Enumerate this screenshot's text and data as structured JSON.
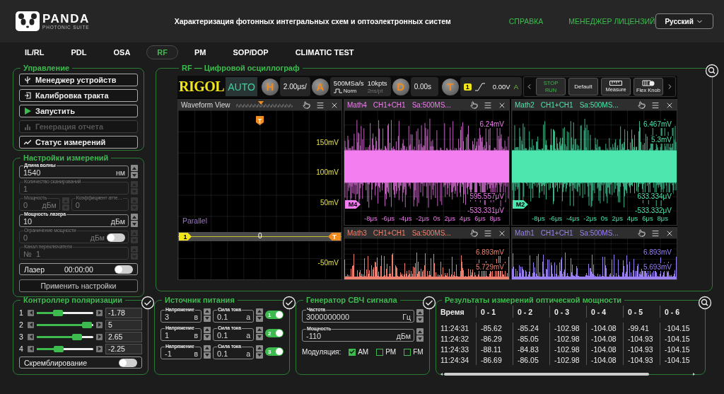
{
  "header": {
    "logo": "PANDA",
    "logo_subtitle": "PHOTONIC SUITE",
    "title": "Характеризация фотонных интегральных схем и оптоэлектронных систем",
    "links": [
      "СПРАВКА",
      "МЕНЕДЖЕР ЛИЦЕНЗИЙ"
    ],
    "language": "Русский"
  },
  "tabs": [
    {
      "label": "IL/RL",
      "selected": false
    },
    {
      "label": "PDL",
      "selected": false
    },
    {
      "label": "OSA",
      "selected": false
    },
    {
      "label": "RF",
      "selected": true
    },
    {
      "label": "PM",
      "selected": false
    },
    {
      "label": "SOP/DOP",
      "selected": false
    },
    {
      "label": "CLIMATIC TEST",
      "selected": false
    }
  ],
  "control": {
    "title": "Управление",
    "buttons": [
      {
        "label": "Менеджер устройств",
        "disabled": false
      },
      {
        "label": "Калибровка тракта",
        "disabled": false
      },
      {
        "label": "Запустить",
        "disabled": false
      },
      {
        "label": "Генерация отчета",
        "disabled": true
      },
      {
        "label": "Статус измерений",
        "disabled": false
      }
    ]
  },
  "settings": {
    "title": "Настройки измерений",
    "rows": [
      {
        "kind": "single",
        "fields": [
          {
            "label": "Длина волны",
            "value": "1540",
            "unit": "нм",
            "disabled": false
          }
        ]
      },
      {
        "kind": "single",
        "fields": [
          {
            "label": "Количество сканирований",
            "value": "1",
            "disabled": true
          }
        ]
      },
      {
        "kind": "pair",
        "fields": [
          {
            "label": "Мощность",
            "value": "0",
            "unit": "дБм",
            "disabled": true
          },
          {
            "label": "Коэффициент атте…",
            "value": "0",
            "disabled": true
          }
        ]
      },
      {
        "kind": "single",
        "fields": [
          {
            "label": "Мощность лазера",
            "value": "10",
            "unit": "дБм",
            "disabled": false
          }
        ]
      },
      {
        "kind": "toggle",
        "on": false,
        "fields": [
          {
            "label": "Ограничение мощности",
            "value": "0",
            "unit": "дБм",
            "disabled": true
          }
        ]
      },
      {
        "kind": "single",
        "fields": [
          {
            "label": "Канал переключателя",
            "value": "№  1",
            "disabled": true
          }
        ]
      }
    ],
    "laser": {
      "label": "Лазер",
      "time": "00:00:00",
      "on": false
    },
    "apply": "Применить настройки"
  },
  "scope": {
    "title": "RF — Цифровой осциллограф",
    "brand": "RIGOL",
    "mode": "AUTO",
    "horizontal": {
      "key": "H",
      "value": "2.00μs/"
    },
    "acquire": {
      "key": "A",
      "rate": "500MSa/s",
      "mode": "Norm",
      "points": "10kpts",
      "resolution": "2ns/pt"
    },
    "delay": {
      "key": "D",
      "value": "0.00s"
    },
    "trigger": {
      "key": "T",
      "channel": "1",
      "level": "0.00V",
      "mode": "A"
    },
    "buttons": [
      {
        "kind": "stoprun",
        "lines": [
          "STOP",
          "RUN"
        ]
      },
      {
        "kind": "default",
        "label": "Default"
      },
      {
        "kind": "measure",
        "label": "Measure"
      },
      {
        "kind": "knob",
        "label": "Flex Knob"
      }
    ],
    "waveform_view": {
      "title": "Waveform View",
      "y_labels": [
        "150mV",
        "100mV",
        "50mV",
        "-50mV"
      ],
      "mode": "Parallel",
      "channel": "1",
      "center": "0",
      "trigger": "T",
      "top_marker": "T"
    },
    "math_windows": [
      {
        "name": "Math4",
        "source": "CH1+CH1",
        "rate": "Sa:500MS...",
        "color": "#f27ef0",
        "readings": [
          "6.24mV"
        ],
        "bottom_readings": [
          "595.557μV",
          "-533.331μV"
        ],
        "marker": "M4",
        "x_ticks": [
          "-8μs",
          "-6μs",
          "-4μs",
          "-2μs",
          "0s",
          "2μs",
          "4μs",
          "6μs",
          "8μs"
        ]
      },
      {
        "name": "Math2",
        "source": "CH1+CH1",
        "rate": "Sa:500MS...",
        "color": "#4de6ae",
        "readings": [
          "6.467mV",
          "5.3mV"
        ],
        "bottom_readings": [
          "633.334μV",
          "-533.332μV"
        ],
        "marker": "M2",
        "x_ticks": [
          "-8μs",
          "-6μs",
          "-4μs",
          "-2μs",
          "0s",
          "2μs",
          "4μs",
          "6μs",
          "8μs"
        ]
      },
      {
        "name": "Math3",
        "source": "CH1+CH1",
        "rate": "Sa:500MS...",
        "color": "#f0806e",
        "readings": [
          "6.893mV",
          "5.729mV"
        ]
      },
      {
        "name": "Math1",
        "source": "CH1+CH1",
        "rate": "Sa:500MS...",
        "color": "#9b80f2",
        "readings": [
          "6.893mV",
          "5.693mV"
        ]
      }
    ]
  },
  "polarization": {
    "title": "Контроллер поляризации",
    "channels": [
      {
        "label": "1",
        "level": 0.35,
        "value": "-1.78"
      },
      {
        "label": "2",
        "level": 0.97,
        "value": "5"
      },
      {
        "label": "3",
        "level": 0.76,
        "value": "2.65"
      },
      {
        "label": "4",
        "level": 0.37,
        "value": "-2.25"
      }
    ],
    "scrambling": {
      "label": "Скремблирование",
      "on": false
    }
  },
  "power": {
    "title": "Источник питания",
    "channels": [
      {
        "voltage": {
          "label": "Напряжение",
          "value": "3",
          "unit": "в"
        },
        "current": {
          "label": "Сила тока",
          "value": "0.1",
          "unit": "а"
        },
        "channel": "1",
        "on": true
      },
      {
        "voltage": {
          "label": "Напряжение",
          "value": "1",
          "unit": "в"
        },
        "current": {
          "label": "Сила тока",
          "value": "0.1",
          "unit": "а"
        },
        "channel": "2",
        "on": true
      },
      {
        "voltage": {
          "label": "Напряжение",
          "value": "-1",
          "unit": "в"
        },
        "current": {
          "label": "Сила тока",
          "value": "0.1",
          "unit": "а"
        },
        "channel": "3",
        "on": true
      }
    ]
  },
  "generator": {
    "title": "Генератор СВЧ сигнала",
    "fields": [
      {
        "label": "Частота",
        "value": "3000000000",
        "unit": "Гц"
      },
      {
        "label": "Мощность",
        "value": "-110",
        "unit": "дБм"
      }
    ],
    "modulation_label": "Модуляция:",
    "modulations": [
      {
        "label": "AM",
        "checked": true
      },
      {
        "label": "PM",
        "checked": false
      },
      {
        "label": "FM",
        "checked": false
      }
    ]
  },
  "results": {
    "title": "Результаты измерений оптической мощности",
    "columns": [
      "Время",
      "0 - 1",
      "0 - 2",
      "0 - 3",
      "0 - 4",
      "0 - 5",
      "0 - 6"
    ],
    "rows": [
      [
        "11:24:31",
        "-85.62",
        "-85.24",
        "-102.98",
        "-104.08",
        "-99.41",
        "-104.15"
      ],
      [
        "11:24:32",
        "-86.29",
        "-85.05",
        "-102.98",
        "-104.08",
        "-104.93",
        "-104.15"
      ],
      [
        "11:24:33",
        "-88.11",
        "-84.83",
        "-102.98",
        "-104.08",
        "-104.93",
        "-104.15"
      ],
      [
        "11:24:34",
        "-86.69",
        "-86.05",
        "-102.98",
        "-104.08",
        "-104.93",
        "-104.15"
      ]
    ]
  }
}
